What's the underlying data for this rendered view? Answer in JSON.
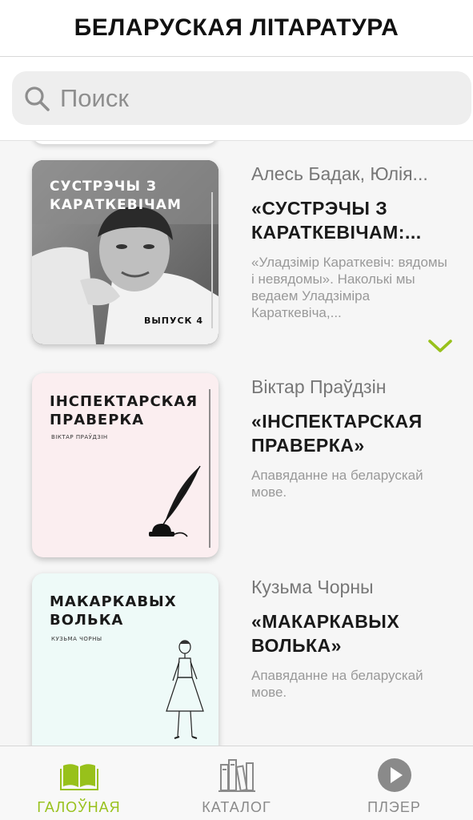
{
  "header": {
    "title": "БЕЛАРУСКАЯ ЛІТАРАТУРА"
  },
  "search": {
    "placeholder": "Поиск",
    "value": ""
  },
  "colors": {
    "accent": "#98c11b",
    "muted": "#8a8a8a"
  },
  "items": [
    {
      "author": "Алесь Бадак, Юлія...",
      "title": "«СУСТРЭЧЫ З КАРАТКЕВІЧАМ:...",
      "description": "«Уладзімір Караткевіч: вядомы і невядомы». Наколькі мы ведаем Уладзіміра Караткевіча,...",
      "cover_title": "СУСТРЭЧЫ З\nКАРАТКЕВІЧАМ",
      "cover_badge": "ВЫПУСК 4",
      "cover_style": "photo",
      "expand_icon": "chevron-down-icon"
    },
    {
      "author": "Віктар Праўдзін",
      "title": "«ІНСПЕКТАРСКАЯ ПРАВЕРКА»",
      "description": "Апавяданне на беларускай мове.",
      "cover_title": "ІНСПЕКТАРСКАЯ\nПРАВЕРКА",
      "cover_author": "ВІКТАР ПРАЎДЗІН",
      "cover_color": "#fbeef0",
      "cover_art": "quill-icon"
    },
    {
      "author": "Кузьма Чорны",
      "title": "«МАКАРКАВЫХ ВОЛЬКА»",
      "description": "Апавяданне на беларускай мове.",
      "cover_title": "МАКАРКАВЫХ\nВОЛЬКА",
      "cover_author": "КУЗЬМА ЧОРНЫ",
      "cover_color": "#eefaf8",
      "cover_art": "woman-sketch-icon"
    }
  ],
  "tabbar": {
    "tabs": [
      {
        "label": "ГАЛОЎНАЯ",
        "icon": "open-book-icon",
        "active": true
      },
      {
        "label": "КАТАЛОГ",
        "icon": "bookshelf-icon",
        "active": false
      },
      {
        "label": "ПЛЭЕР",
        "icon": "play-circle-icon",
        "active": false
      }
    ]
  }
}
